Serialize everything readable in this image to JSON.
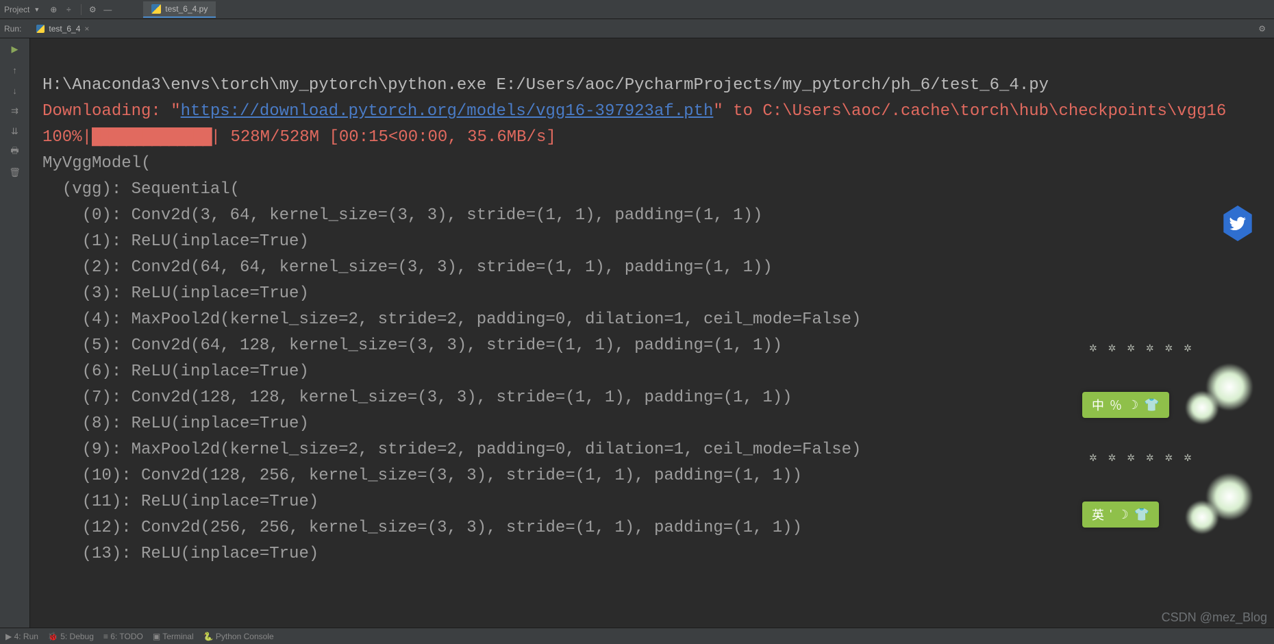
{
  "topBar": {
    "projectLabel": "Project"
  },
  "fileTab": {
    "name": "test_6_4.py"
  },
  "runBar": {
    "label": "Run:",
    "tabName": "test_6_4"
  },
  "console": {
    "cmdLine": "H:\\Anaconda3\\envs\\torch\\my_pytorch\\python.exe E:/Users/aoc/PycharmProjects/my_pytorch/ph_6/test_6_4.py",
    "downloadingPrefix": "Downloading: \"",
    "downloadUrl": "https://download.pytorch.org/models/vgg16-397923af.pth",
    "downloadingSuffix": "\" to C:\\Users\\aoc/.cache\\torch\\hub\\checkpoints\\vgg16",
    "progressPercent": "100%",
    "progressBlocks": "██████████████",
    "progressStats": " 528M/528M [00:15<00:00, 35.6MB/s]",
    "modelLines": [
      "MyVggModel(",
      "  (vgg): Sequential(",
      "    (0): Conv2d(3, 64, kernel_size=(3, 3), stride=(1, 1), padding=(1, 1))",
      "    (1): ReLU(inplace=True)",
      "    (2): Conv2d(64, 64, kernel_size=(3, 3), stride=(1, 1), padding=(1, 1))",
      "    (3): ReLU(inplace=True)",
      "    (4): MaxPool2d(kernel_size=2, stride=2, padding=0, dilation=1, ceil_mode=False)",
      "    (5): Conv2d(64, 128, kernel_size=(3, 3), stride=(1, 1), padding=(1, 1))",
      "    (6): ReLU(inplace=True)",
      "    (7): Conv2d(128, 128, kernel_size=(3, 3), stride=(1, 1), padding=(1, 1))",
      "    (8): ReLU(inplace=True)",
      "    (9): MaxPool2d(kernel_size=2, stride=2, padding=0, dilation=1, ceil_mode=False)",
      "    (10): Conv2d(128, 256, kernel_size=(3, 3), stride=(1, 1), padding=(1, 1))",
      "    (11): ReLU(inplace=True)",
      "    (12): Conv2d(256, 256, kernel_size=(3, 3), stride=(1, 1), padding=(1, 1))",
      "    (13): ReLU(inplace=True)"
    ]
  },
  "bottomBar": {
    "items": [
      "▶ 4: Run",
      "🐞 5: Debug",
      "≡ 6: TODO",
      "▣ Terminal",
      "🐍 Python Console"
    ]
  },
  "ime": {
    "w1": {
      "lang": "中",
      "symbols": [
        "％",
        "☽",
        "👕"
      ]
    },
    "w2": {
      "lang": "英",
      "symbols": [
        "'",
        "☽",
        "👕"
      ]
    }
  },
  "watermark": "CSDN @mez_Blog"
}
